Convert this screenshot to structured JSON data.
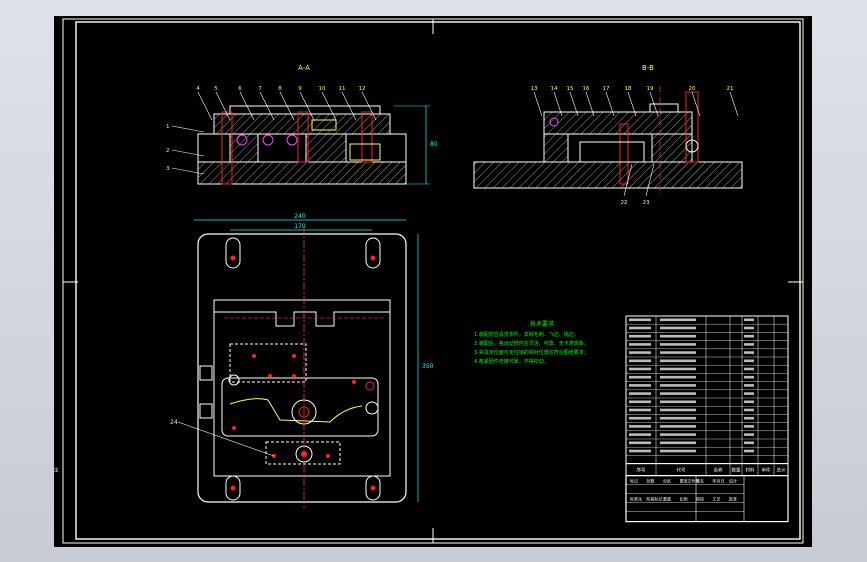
{
  "drawing": {
    "view_a_title": "A-A",
    "view_b_title": "B-B",
    "notes_title": "技术要求",
    "notes": [
      "1.装配前应清洗零件，去除毛刺、飞边、锐边；",
      "2.装配后，各运动部件应灵活、可靠，无卡滞现象；",
      "3.夹具定位面与定位销的相对位置应符合图纸要求；",
      "4.各紧固件连接可靠，不得松动。"
    ],
    "dim_width_label": "240",
    "dim_inner_label": "170",
    "dim_height_label": "350",
    "dim_side_label": "80",
    "balloons_view_a": [
      "4",
      "5",
      "6",
      "7",
      "8",
      "9",
      "10",
      "11",
      "12",
      "1",
      "2",
      "3"
    ],
    "balloons_view_b": [
      "13",
      "14",
      "15",
      "16",
      "17",
      "18",
      "19",
      "20",
      "21",
      "22",
      "23"
    ],
    "balloon_plan": "24",
    "title_block": {
      "rows": 18,
      "header": [
        "序号",
        "代号",
        "名称",
        "数量",
        "材料",
        "单件",
        "总计",
        "备注"
      ],
      "bottom_labels": [
        "标记",
        "处数",
        "分区",
        "更改文件号",
        "签名",
        "年月日",
        "设计",
        "标准化",
        "阶段标记",
        "重量",
        "比例",
        "审核",
        "工艺",
        "批准"
      ]
    }
  },
  "colors": {
    "background": "#000000",
    "outline": "#ffffff",
    "hatch": "#c8c8c8",
    "dimension": "#00ffff",
    "centerline": "#ff3333",
    "notes": "#00ff00",
    "balloon": "#ffff00",
    "part_red": "#ff2020",
    "part_magenta": "#ff40ff",
    "part_yellow": "#ffff40"
  }
}
